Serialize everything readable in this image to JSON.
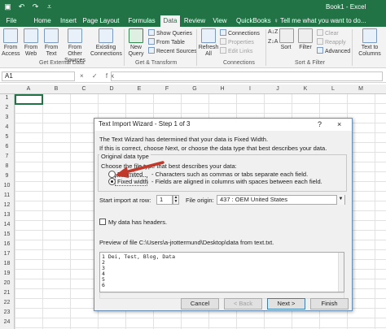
{
  "window": {
    "title": "Book1 - Excel"
  },
  "tabs": [
    "File",
    "Home",
    "Insert",
    "Page Layout",
    "Formulas",
    "Data",
    "Review",
    "View",
    "QuickBooks"
  ],
  "active_tab": "Data",
  "tell_me": "Tell me what you want to do...",
  "ribbon": {
    "get_external": {
      "access": "From Access",
      "web": "From Web",
      "text": "From Text",
      "other": "From Other Sources",
      "existing": "Existing Connections",
      "label": "Get External Data"
    },
    "get_transform": {
      "new_query": "New Query",
      "show_queries": "Show Queries",
      "from_table": "From Table",
      "recent_sources": "Recent Sources",
      "label": "Get & Transform"
    },
    "connections": {
      "refresh_all": "Refresh All",
      "connections": "Connections",
      "properties": "Properties",
      "edit_links": "Edit Links",
      "label": "Connections"
    },
    "sort_filter": {
      "sort": "Sort",
      "filter": "Filter",
      "clear": "Clear",
      "reapply": "Reapply",
      "advanced": "Advanced",
      "label": "Sort & Filter"
    },
    "text_to_columns": "Text to Columns"
  },
  "formula_bar": {
    "name_box": "A1",
    "fx": "× ✓ fx"
  },
  "columns": [
    "A",
    "B",
    "C",
    "D",
    "E",
    "F",
    "G",
    "H",
    "I",
    "J",
    "K",
    "L",
    "M",
    "N"
  ],
  "rows": [
    "1",
    "2",
    "3",
    "4",
    "5",
    "6",
    "7",
    "8",
    "9",
    "10",
    "11",
    "12",
    "13",
    "14",
    "15",
    "16",
    "17",
    "18",
    "19",
    "20",
    "21",
    "22",
    "23",
    "24"
  ],
  "dialog": {
    "title": "Text Import Wizard - Step 1 of 3",
    "help": "?",
    "close": "×",
    "intro1": "The Text Wizard has determined that your data is Fixed Width.",
    "intro2": "If this is correct, choose Next, or choose the data type that best describes your data.",
    "original_data_type": "Original data type",
    "choose_label": "Choose the file type that best describes your data:",
    "delimited_label": "Delimited",
    "delimited_desc": "- Characters such as commas or tabs separate each field.",
    "fixed_label": "Fixed width",
    "fixed_desc": "- Fields are aligned in columns with spaces between each field.",
    "start_row_label": "Start import at row:",
    "start_row_value": "1",
    "file_origin_label": "File origin:",
    "file_origin_value": "437 : OEM United States",
    "headers_label": "My data has headers.",
    "preview_label": "Preview of file C:\\Users\\a-jrottermund\\Desktop\\data from text.txt.",
    "preview_lines": [
      "1 Dei, Test, Blog, Data",
      "2",
      "3",
      "4",
      "5",
      "6"
    ],
    "buttons": {
      "cancel": "Cancel",
      "back": "< Back",
      "next": "Next >",
      "finish": "Finish"
    }
  }
}
